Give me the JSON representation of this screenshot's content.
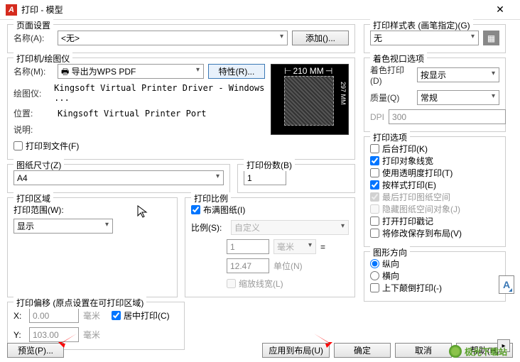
{
  "window": {
    "title": "打印 - 模型"
  },
  "pageSetup": {
    "title": "页面设置",
    "nameLabel": "名称(A):",
    "nameValue": "<无>",
    "addBtn": "添加()..."
  },
  "printer": {
    "title": "打印机/绘图仪",
    "nameLabel": "名称(M):",
    "nameValue": "导出为WPS PDF",
    "propsBtn": "特性(R)...",
    "plotterLabel": "绘图仪:",
    "plotterValue": "Kingsoft Virtual Printer Driver - Windows ...",
    "locationLabel": "位置:",
    "locationValue": "Kingsoft Virtual Printer Port",
    "descLabel": "说明:",
    "toFile": "打印到文件(F)",
    "paperW": "210 MM",
    "paperH": "297 MM"
  },
  "paperSize": {
    "title": "图纸尺寸(Z)",
    "value": "A4"
  },
  "copies": {
    "title": "打印份数(B)",
    "value": "1"
  },
  "area": {
    "title": "打印区域",
    "rangeLabel": "打印范围(W):",
    "rangeValue": "显示"
  },
  "scale": {
    "title": "打印比例",
    "fit": "布满图纸(I)",
    "ratioLabel": "比例(S):",
    "ratioValue": "自定义",
    "num1": "1",
    "unit1": "毫米",
    "eq": "=",
    "num2": "12.47",
    "unit2": "单位(N)",
    "lineweights": "缩放线宽(L)"
  },
  "offset": {
    "title": "打印偏移 (原点设置在可打印区域)",
    "xLabel": "X:",
    "xValue": "0.00",
    "xUnit": "毫米",
    "yLabel": "Y:",
    "yValue": "103.00",
    "yUnit": "毫米",
    "center": "居中打印(C)"
  },
  "styleTable": {
    "title": "打印样式表 (画笔指定)(G)",
    "value": "无"
  },
  "shaded": {
    "title": "着色视口选项",
    "shadeLabel": "着色打印(D)",
    "shadeValue": "按显示",
    "qualityLabel": "质量(Q)",
    "qualityValue": "常规",
    "dpiLabel": "DPI",
    "dpiValue": "300"
  },
  "options": {
    "title": "打印选项",
    "o1": "后台打印(K)",
    "o2": "打印对象线宽",
    "o3": "使用透明度打印(T)",
    "o4": "按样式打印(E)",
    "o5": "最后打印图纸空间",
    "o6": "隐藏图纸空间对象(J)",
    "o7": "打开打印戳记",
    "o8": "将修改保存到布局(V)"
  },
  "orient": {
    "title": "图形方向",
    "r1": "纵向",
    "r2": "横向",
    "r3": "上下颠倒打印(-)"
  },
  "footer": {
    "preview": "预览(P)...",
    "applyLayout": "应用到布局(U)",
    "ok": "确定",
    "cancel": "取消",
    "help": "帮助(H)"
  },
  "watermark": "极光下载站"
}
